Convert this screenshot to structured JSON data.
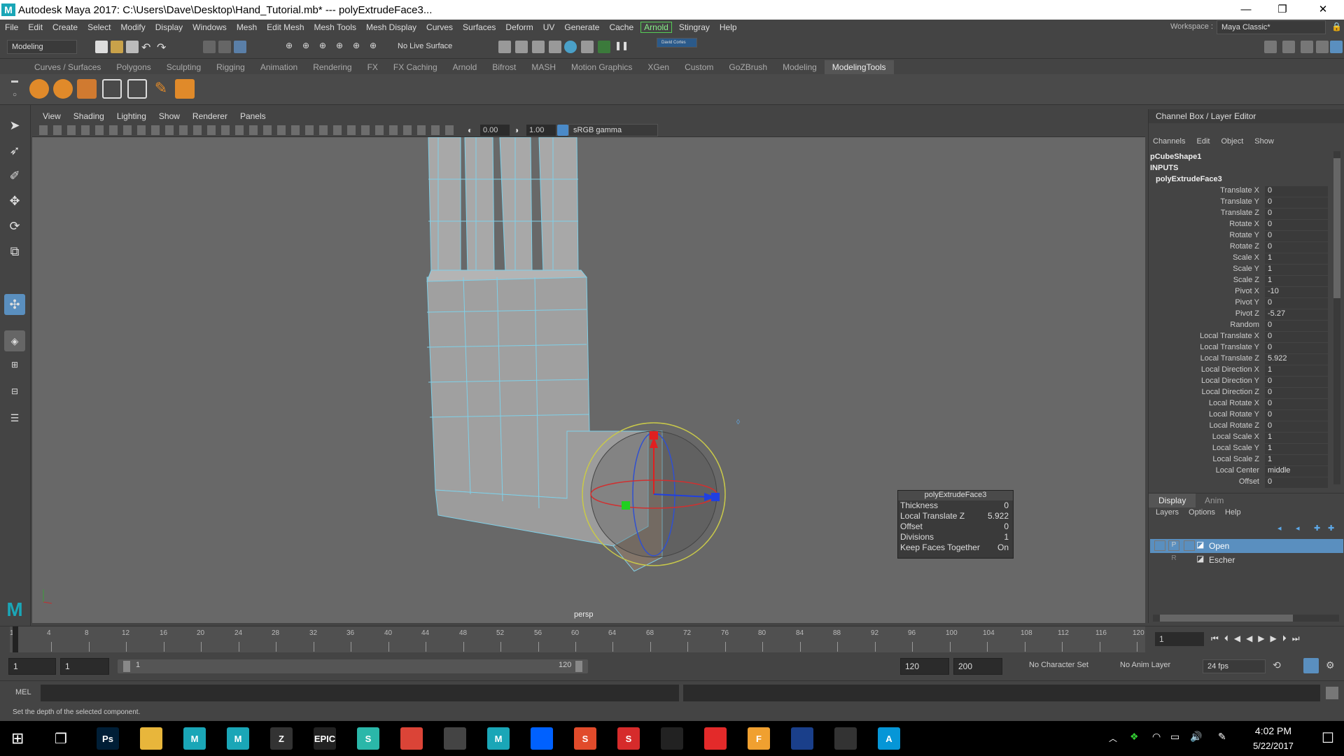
{
  "window": {
    "app_title": "Autodesk Maya 2017: C:\\Users\\Dave\\Desktop\\Hand_Tutorial.mb*   ---   polyExtrudeFace3..."
  },
  "menus": [
    "File",
    "Edit",
    "Create",
    "Select",
    "Modify",
    "Display",
    "Windows",
    "Mesh",
    "Edit Mesh",
    "Mesh Tools",
    "Mesh Display",
    "Curves",
    "Surfaces",
    "Deform",
    "UV",
    "Generate",
    "Cache",
    "Arnold",
    "Stingray",
    "Help"
  ],
  "workspace": {
    "label": "Workspace :",
    "value": "Maya Classic*"
  },
  "status": {
    "mode": "Modeling",
    "live_surface": "No Live Surface",
    "user": "David Cortes"
  },
  "shelf_tabs": [
    "Curves / Surfaces",
    "Polygons",
    "Sculpting",
    "Rigging",
    "Animation",
    "Rendering",
    "FX",
    "FX Caching",
    "Arnold",
    "Bifrost",
    "MASH",
    "Motion Graphics",
    "XGen",
    "Custom",
    "GoZBrush",
    "Modeling",
    "ModelingTools"
  ],
  "shelf_active": "ModelingTools",
  "viewport": {
    "menus": [
      "View",
      "Shading",
      "Lighting",
      "Show",
      "Renderer",
      "Panels"
    ],
    "exposure": "0.00",
    "gamma": "1.00",
    "color_space": "sRGB gamma",
    "camera_label": "persp"
  },
  "popup": {
    "title": "polyExtrudeFace3",
    "rows": [
      {
        "label": "Thickness",
        "value": "0"
      },
      {
        "label": "Local Translate Z",
        "value": "5.922"
      },
      {
        "label": "Offset",
        "value": "0"
      },
      {
        "label": "Divisions",
        "value": "1"
      },
      {
        "label": "Keep Faces Together",
        "value": "On"
      }
    ]
  },
  "channel_box": {
    "header": "Channel Box / Layer Editor",
    "menus": [
      "Channels",
      "Edit",
      "Object",
      "Show"
    ],
    "shape": "pCubeShape1",
    "inputs_label": "INPUTS",
    "node": "polyExtrudeFace3",
    "channels": [
      {
        "label": "Translate X",
        "value": "0"
      },
      {
        "label": "Translate Y",
        "value": "0"
      },
      {
        "label": "Translate Z",
        "value": "0"
      },
      {
        "label": "Rotate X",
        "value": "0"
      },
      {
        "label": "Rotate Y",
        "value": "0"
      },
      {
        "label": "Rotate Z",
        "value": "0"
      },
      {
        "label": "Scale X",
        "value": "1"
      },
      {
        "label": "Scale Y",
        "value": "1"
      },
      {
        "label": "Scale Z",
        "value": "1"
      },
      {
        "label": "Pivot X",
        "value": "-10"
      },
      {
        "label": "Pivot Y",
        "value": "0"
      },
      {
        "label": "Pivot Z",
        "value": "-5.27"
      },
      {
        "label": "Random",
        "value": "0"
      },
      {
        "label": "Local Translate X",
        "value": "0"
      },
      {
        "label": "Local Translate Y",
        "value": "0"
      },
      {
        "label": "Local Translate Z",
        "value": "5.922"
      },
      {
        "label": "Local Direction X",
        "value": "1"
      },
      {
        "label": "Local Direction Y",
        "value": "0"
      },
      {
        "label": "Local Direction Z",
        "value": "0"
      },
      {
        "label": "Local Rotate X",
        "value": "0"
      },
      {
        "label": "Local Rotate Y",
        "value": "0"
      },
      {
        "label": "Local Rotate Z",
        "value": "0"
      },
      {
        "label": "Local Scale X",
        "value": "1"
      },
      {
        "label": "Local Scale Y",
        "value": "1"
      },
      {
        "label": "Local Scale Z",
        "value": "1"
      },
      {
        "label": "Local Center",
        "value": "middle"
      },
      {
        "label": "Offset",
        "value": "0"
      }
    ]
  },
  "layer_editor": {
    "tabs": [
      "Display",
      "Anim"
    ],
    "menus": [
      "Layers",
      "Options",
      "Help"
    ],
    "layers": [
      {
        "name": "Open",
        "selected": true,
        "flag": "P"
      },
      {
        "name": "Escher",
        "selected": false,
        "flag": "R"
      }
    ]
  },
  "timeline": {
    "ticks": [
      "1",
      "4",
      "8",
      "12",
      "16",
      "20",
      "24",
      "28",
      "32",
      "36",
      "40",
      "44",
      "48",
      "52",
      "56",
      "60",
      "64",
      "68",
      "72",
      "76",
      "80",
      "84",
      "88",
      "92",
      "96",
      "100",
      "104",
      "108",
      "112",
      "116",
      "120"
    ],
    "current_frame": "1"
  },
  "range": {
    "start": "1",
    "anim_start": "1",
    "slider_start": "1",
    "slider_end": "120",
    "end": "120",
    "anim_end": "200",
    "character_set": "No Character Set",
    "anim_layer": "No Anim Layer",
    "fps": "24 fps"
  },
  "command_line": {
    "label": "MEL"
  },
  "help_line": "Set the depth of the selected component.",
  "taskbar": {
    "time": "4:02 PM",
    "date": "5/22/2017",
    "apps": [
      {
        "name": "photoshop",
        "label": "Ps",
        "color": "#001e36"
      },
      {
        "name": "file-explorer",
        "label": "",
        "color": "#e8b63b"
      },
      {
        "name": "maya-a",
        "label": "M",
        "color": "#1aa6b7"
      },
      {
        "name": "maya-b",
        "label": "M",
        "color": "#1aa6b7"
      },
      {
        "name": "zbrush",
        "label": "Z",
        "color": "#333333"
      },
      {
        "name": "epic-games",
        "label": "EPIC",
        "color": "#222222"
      },
      {
        "name": "substance",
        "label": "S",
        "color": "#2ab7a9"
      },
      {
        "name": "chrome",
        "label": "",
        "color": "#db4437"
      },
      {
        "name": "calculator",
        "label": "",
        "color": "#444444"
      },
      {
        "name": "maya-active",
        "label": "M",
        "color": "#1aa6b7"
      },
      {
        "name": "dropbox",
        "label": "",
        "color": "#0061ff"
      },
      {
        "name": "substance-designer",
        "label": "S",
        "color": "#e14b2b"
      },
      {
        "name": "substance-painter",
        "label": "S",
        "color": "#d62b2b"
      },
      {
        "name": "unity",
        "label": "",
        "color": "#222222"
      },
      {
        "name": "acrobat",
        "label": "",
        "color": "#e32a2a"
      },
      {
        "name": "fusion",
        "label": "F",
        "color": "#f0a030"
      },
      {
        "name": "app-blue",
        "label": "",
        "color": "#1a3f8a"
      },
      {
        "name": "oculus",
        "label": "",
        "color": "#333333"
      },
      {
        "name": "autodesk",
        "label": "A",
        "color": "#0696d7"
      }
    ]
  },
  "colors": {
    "accent": "#5da9e9",
    "arnold": "#55cc55",
    "selected_layer": "#5a8fbf"
  }
}
